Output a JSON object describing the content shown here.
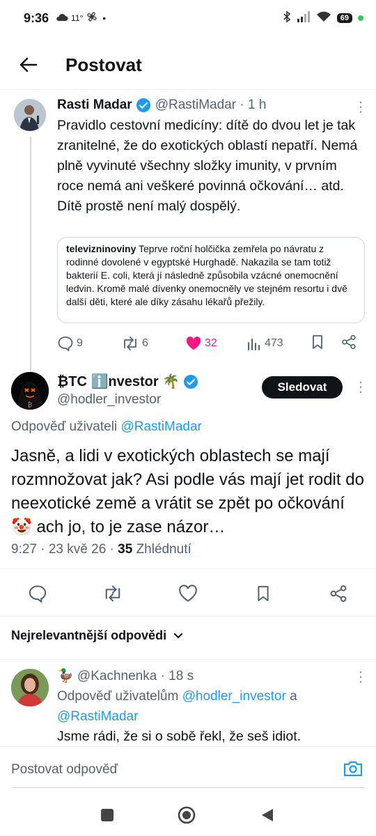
{
  "status_bar": {
    "time": "9:36",
    "weather": "11°",
    "battery": "69"
  },
  "header": {
    "title": "Postovat"
  },
  "parent_tweet": {
    "author_name": "Rasti Madar",
    "author_handle": "@RastiMadar · 1 h",
    "text": "Pravidlo cestovní medicíny: dítě do dvou let je tak zranitelné, že do exotických oblastí nepatří. Nemá plně vyvinuté všechny složky imunity, v prvním roce nemá ani veškeré povinná očkování… atd. Dítě prostě není malý dospělý.",
    "quote": {
      "source": "televizninoviny",
      "text": "Teprve roční holčička zemřela po návratu z rodinné dovolené v egyptské Hurghadě. Nakazila se tam totiž bakterií E. coli, která jí následně způsobila vzácné onemocnění ledvin. Kromě malé dívenky onemocněly ve stejném resortu i dvě další děti, které ale díky zásahu lékařů přežily."
    },
    "stats": {
      "replies": "9",
      "reposts": "6",
      "likes": "32",
      "views": "473"
    }
  },
  "main_tweet": {
    "author_name": "₿TC ℹ️nvestor 🌴",
    "author_handle": "@hodler_investor",
    "follow_label": "Sledovat",
    "reply_to_label": "Odpověď uživateli",
    "reply_to_handle": "@RastiMadar",
    "text": "Jasně, a lidi v exotických oblastech se mají rozmnožovat jak? Asi podle vás mají jet rodit do neexotické země a vrátit se zpět po očkování 🤡 ach jo, to je zase názor…",
    "meta_time": "9:27 · 23 kvě 26 · ",
    "meta_views_count": "35",
    "meta_views_label": "Zhlédnutí"
  },
  "sort_label": "Nejrelevantnější odpovědi",
  "reply": {
    "author": "🦆 @Kachnenka · 18 s",
    "reply_to_label": "Odpověď uživatelům",
    "reply_to_handle_1": "@hodler_investor",
    "reply_to_conj": "a",
    "reply_to_handle_2": "@RastiMadar",
    "text": "Jsme rádi, že si o sobě řekl, že seš idiot."
  },
  "composer": {
    "placeholder": "Postovat odpověď"
  },
  "colors": {
    "accent": "#1d9bf0",
    "like": "#f91880",
    "text": "#0f1419",
    "secondary": "#536471"
  }
}
